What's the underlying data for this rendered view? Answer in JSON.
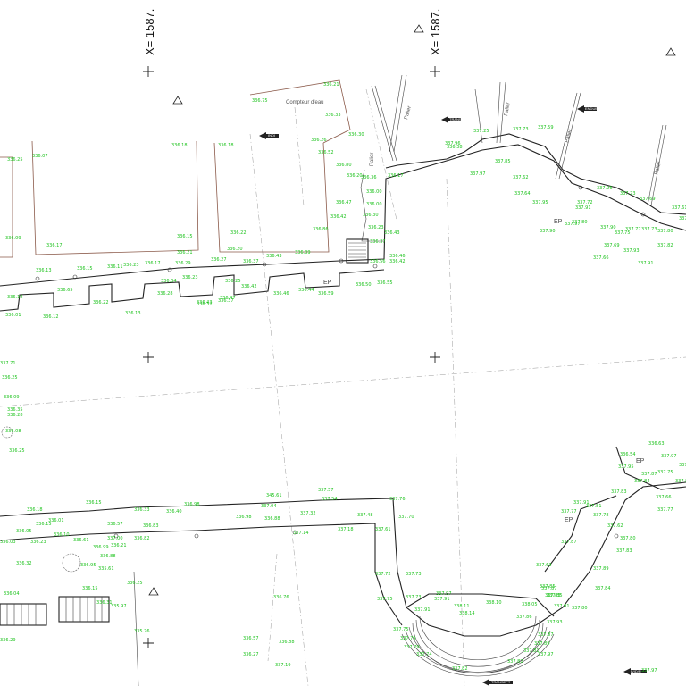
{
  "grid_labels": [
    "X= 1587.",
    "X= 1587."
  ],
  "notes": {
    "meter": "Compteur d'eau",
    "ep": [
      "EP",
      "EP",
      "EP",
      "EP"
    ],
    "paliers": [
      "Palier",
      "Palier",
      "Palier",
      "Palier",
      "Palier"
    ],
    "tags": [
      "INDI",
      "TRANSEPT",
      "ENDUE",
      "TRANSEPT",
      "B/ID/R"
    ]
  },
  "elevations": {
    "top_left": [
      "336.07",
      "336.18",
      "336.18",
      "336.15",
      "336.22",
      "336.21",
      "336.20",
      "336.29",
      "336.17",
      "336.27",
      "336.37",
      "336.23",
      "336.17",
      "336.23",
      "336.13",
      "336.15",
      "336.11",
      "336.12",
      "336.28",
      "336.32",
      "336.37",
      "336.43",
      "336.39",
      "336.65",
      "336.34",
      "336.25",
      "336.43",
      "336.47",
      "336.42",
      "336.46",
      "336.44",
      "336.59",
      "336.50",
      "336.22",
      "336.12",
      "336.01",
      "336.09",
      "336.25",
      "336.13"
    ],
    "top_mid": [
      "336.75",
      "336.21",
      "336.33",
      "336.26",
      "336.30",
      "336.52",
      "336.20",
      "336.47",
      "336.42",
      "336.36",
      "336.00",
      "336.30",
      "336.23",
      "336.37",
      "336.43",
      "336.46",
      "336.56",
      "336.42",
      "336.55",
      "336.17",
      "336.00",
      "336.80",
      "336.86"
    ],
    "top_right": [
      "336.38",
      "337.25",
      "337.73",
      "337.59",
      "337.96",
      "337.97",
      "337.85",
      "337.62",
      "337.64",
      "337.95",
      "337.90",
      "337.97",
      "337.91",
      "337.72",
      "337.96",
      "337.73",
      "337.69",
      "337.69",
      "337.75",
      "337.77",
      "337.90",
      "337.93",
      "337.91",
      "337.73",
      "337.80",
      "337.82",
      "337.61",
      "337.64",
      "337.66",
      "337.80"
    ],
    "left_edge": [
      "337.71",
      "336.25",
      "336.09",
      "336.35",
      "336.28",
      "336.08",
      "336.25"
    ],
    "bottom_left": [
      "336.18",
      "336.15",
      "336.01",
      "336.05",
      "336.23",
      "336.03",
      "336.32",
      "336.33",
      "336.40",
      "336.98",
      "336.57",
      "336.83",
      "336.82",
      "336.61",
      "336.99",
      "336.88",
      "336.95",
      "336.15",
      "336.25",
      "336.10",
      "337.00",
      "336.21",
      "336.04",
      "335.61",
      "336.31",
      "335.76",
      "336.29",
      "335.97",
      "336.15"
    ],
    "bottom_mid": [
      "345.61",
      "337.04",
      "336.88",
      "337.32",
      "337.14",
      "337.18",
      "336.98",
      "337.57",
      "337.54",
      "337.48",
      "337.61",
      "337.70",
      "337.76",
      "337.72",
      "337.73",
      "337.75",
      "337.73",
      "336.76",
      "336.57",
      "336.27",
      "336.88",
      "337.19"
    ],
    "amphitheatre": [
      "337.97",
      "337.91",
      "337.91",
      "338.11",
      "338.10",
      "338.14",
      "338.05",
      "337.75",
      "337.79",
      "337.79",
      "337.74",
      "337.82",
      "337.97",
      "337.83",
      "337.85",
      "337.91",
      "337.93",
      "337.87",
      "337.89",
      "337.81",
      "337.82",
      "337.86"
    ],
    "bottom_right": [
      "336.54",
      "336.63",
      "337.95",
      "337.97",
      "337.87",
      "337.75",
      "337.84",
      "337.83",
      "337.91",
      "337.81",
      "337.77",
      "337.78",
      "337.87",
      "337.62",
      "337.80",
      "337.83",
      "337.63",
      "337.87",
      "337.89",
      "337.84",
      "337.80",
      "337.85",
      "337.97",
      "337.77",
      "337.66",
      "337.80",
      "337.93"
    ]
  }
}
